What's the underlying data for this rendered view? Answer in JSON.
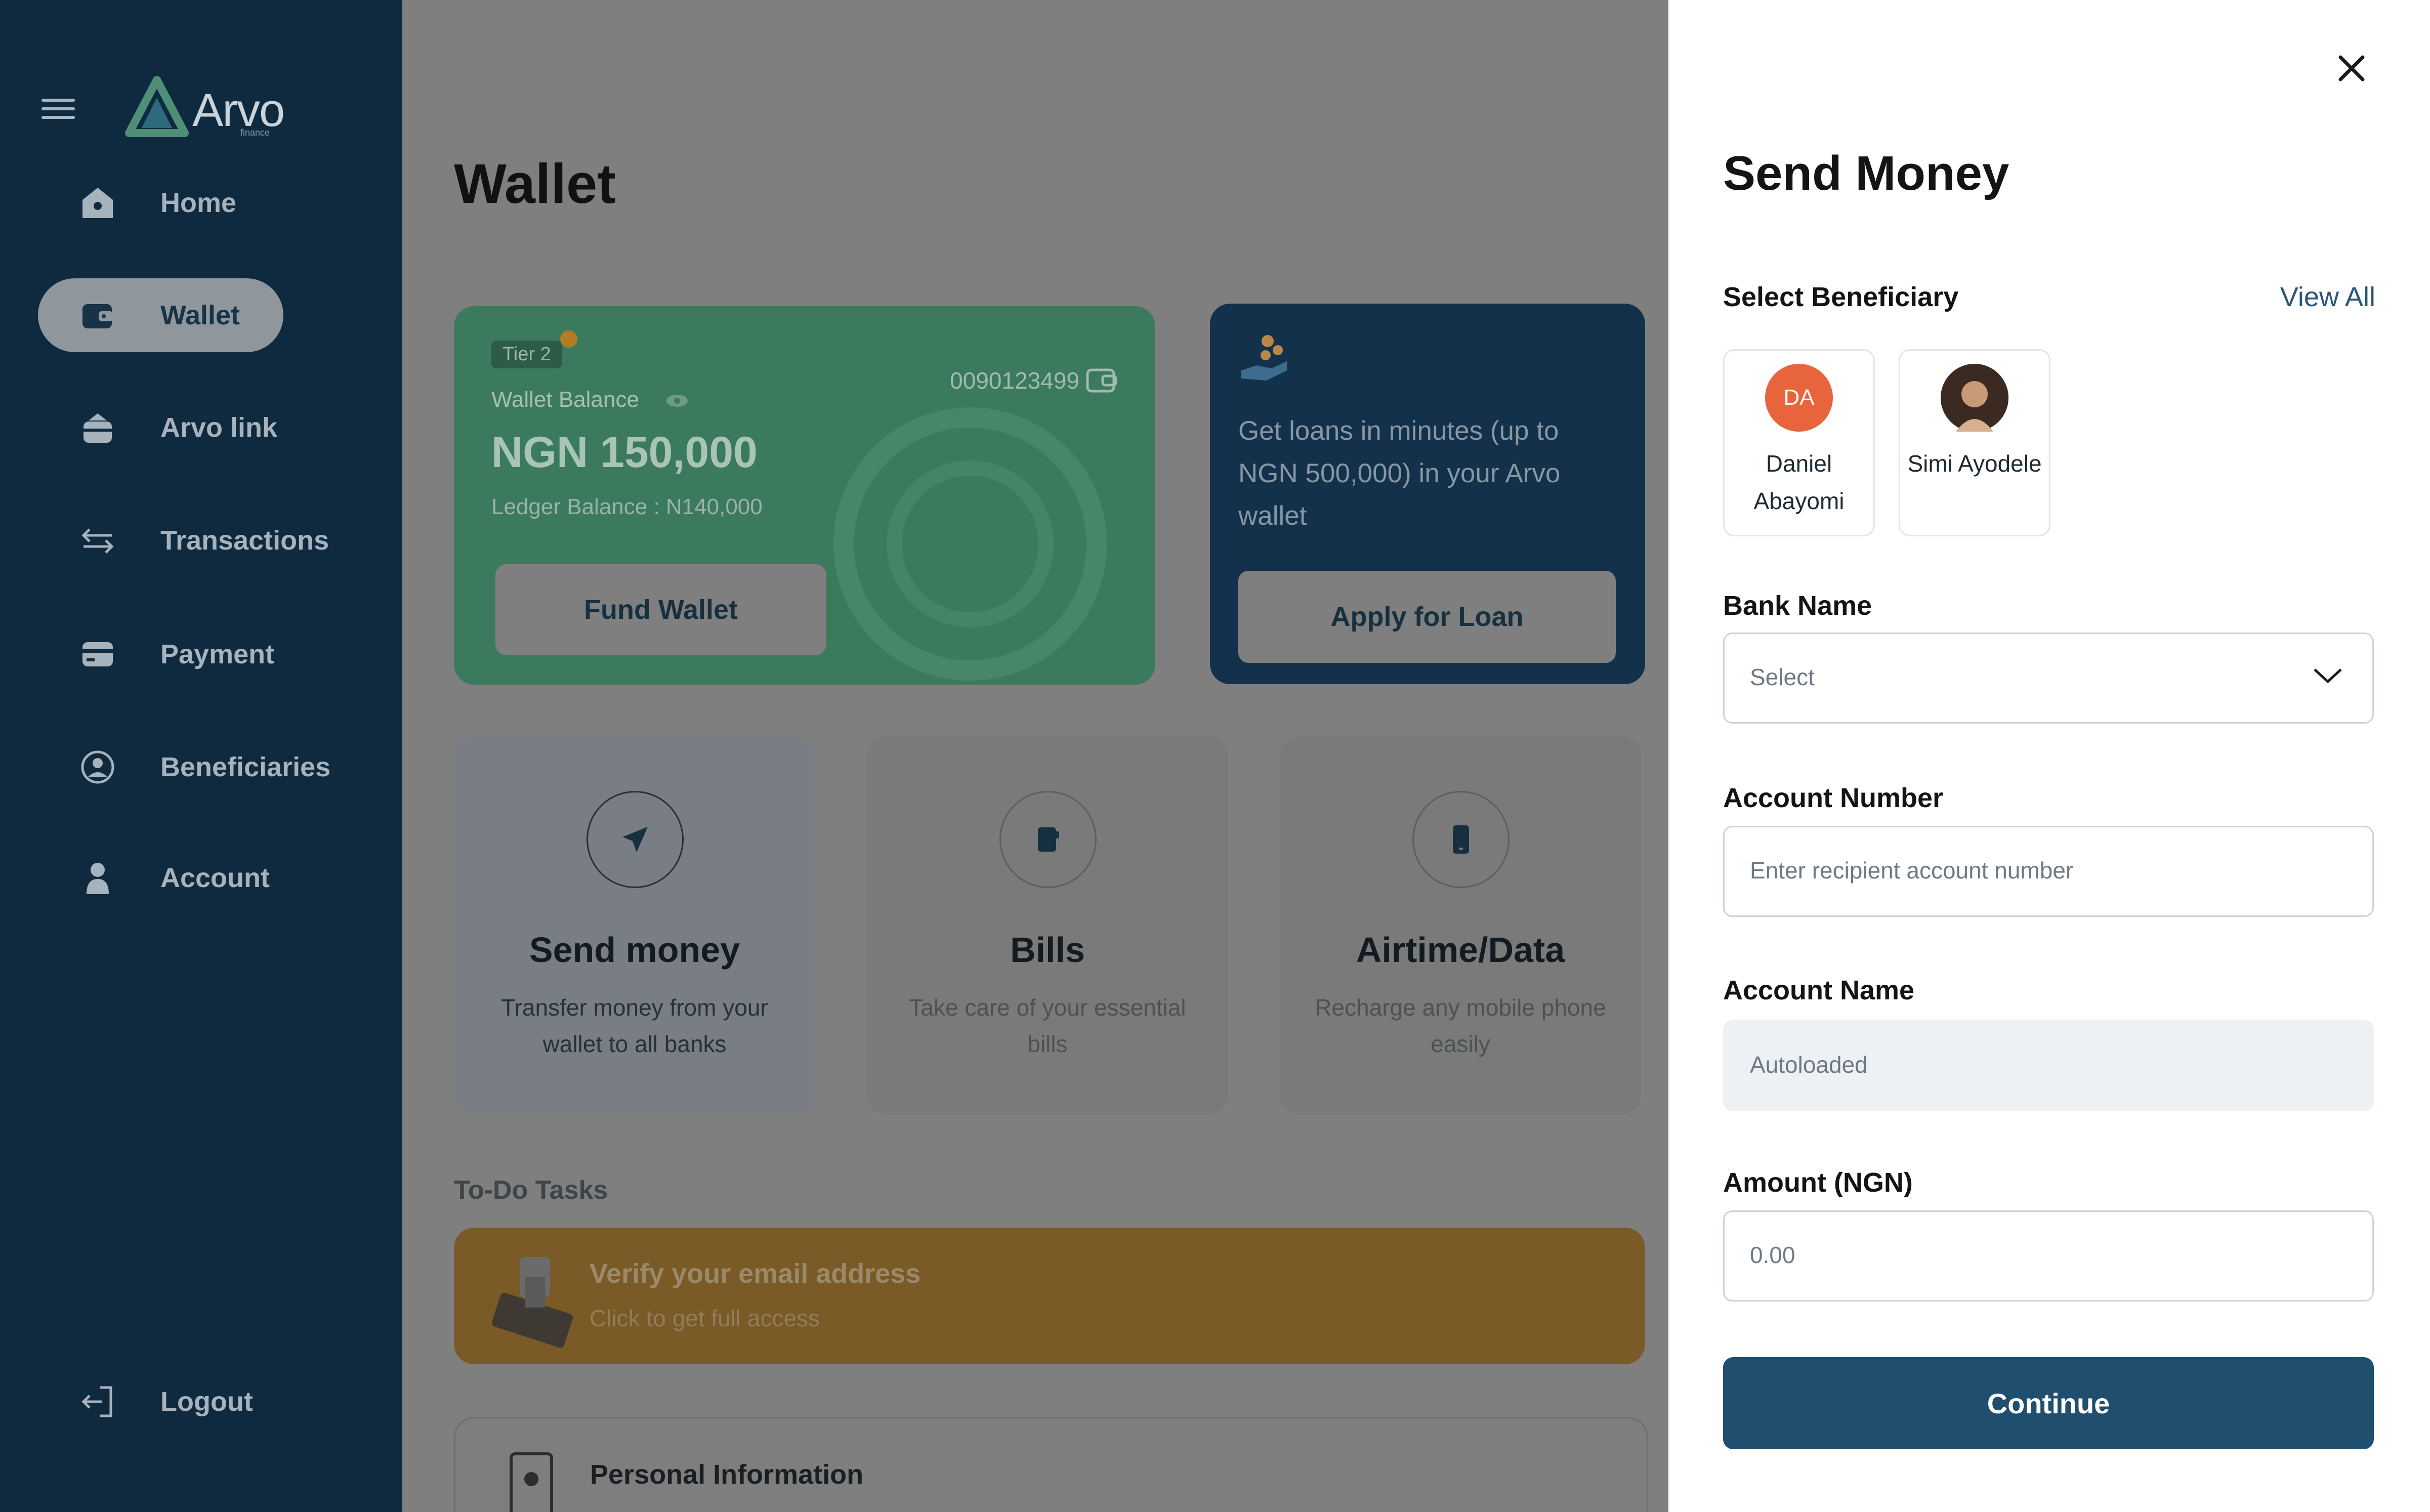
{
  "brand": {
    "name": "Arvo",
    "tagline": "finance"
  },
  "sidebar": {
    "items": [
      {
        "label": "Home",
        "icon": "home-icon"
      },
      {
        "label": "Wallet",
        "icon": "wallet-icon",
        "active": true
      },
      {
        "label": "Arvo link",
        "icon": "arvo-link-icon"
      },
      {
        "label": "Transactions",
        "icon": "transactions-icon"
      },
      {
        "label": "Payment",
        "icon": "payment-icon"
      },
      {
        "label": "Beneficiaries",
        "icon": "beneficiaries-icon"
      },
      {
        "label": "Account",
        "icon": "account-icon"
      }
    ],
    "logout": "Logout"
  },
  "main": {
    "title": "Wallet",
    "wallet_card": {
      "tier": "Tier 2",
      "balance_label": "Wallet Balance",
      "account_number": "0090123499",
      "balance": "NGN 150,000",
      "ledger": "Ledger Balance : N140,000",
      "fund_button": "Fund Wallet"
    },
    "loan_card": {
      "text": "Get loans in minutes (up to NGN 500,000) in your Arvo wallet",
      "button": "Apply for Loan"
    },
    "actions": [
      {
        "title": "Send money",
        "desc": "Transfer money from your wallet to all banks",
        "icon": "send-icon"
      },
      {
        "title": "Bills",
        "desc": "Take care of your essential bills",
        "icon": "bills-icon"
      },
      {
        "title": "Airtime/Data",
        "desc": "Recharge any mobile phone easily",
        "icon": "phone-icon"
      }
    ],
    "todo": {
      "label": "To-Do Tasks",
      "title": "Verify your email address",
      "subtitle": "Click to get full access"
    },
    "personal": {
      "title": "Personal Information"
    }
  },
  "panel": {
    "title": "Send Money",
    "select_beneficiary": "Select Beneficiary",
    "view_all": "View All",
    "beneficiaries": [
      {
        "initials": "DA",
        "name": "Daniel Abayomi",
        "color": "#e8643c"
      },
      {
        "initials": "",
        "name": "Simi Ayodele",
        "color": "#5a4032"
      }
    ],
    "bank_name": {
      "label": "Bank Name",
      "value": "Select"
    },
    "account_number": {
      "label": "Account Number",
      "placeholder": "Enter recipient account number"
    },
    "account_name": {
      "label": "Account Name",
      "value": "Autoloaded"
    },
    "amount": {
      "label": "Amount (NGN)",
      "placeholder": "0.00"
    },
    "continue": "Continue"
  },
  "colors": {
    "sidebar": "#0f2a3f",
    "primary": "#1f4e6e",
    "wallet_card": "#3c7a5e",
    "loan_card": "#13314a",
    "todo_card": "#7a5a26",
    "overlay": "#7f7f7f"
  }
}
